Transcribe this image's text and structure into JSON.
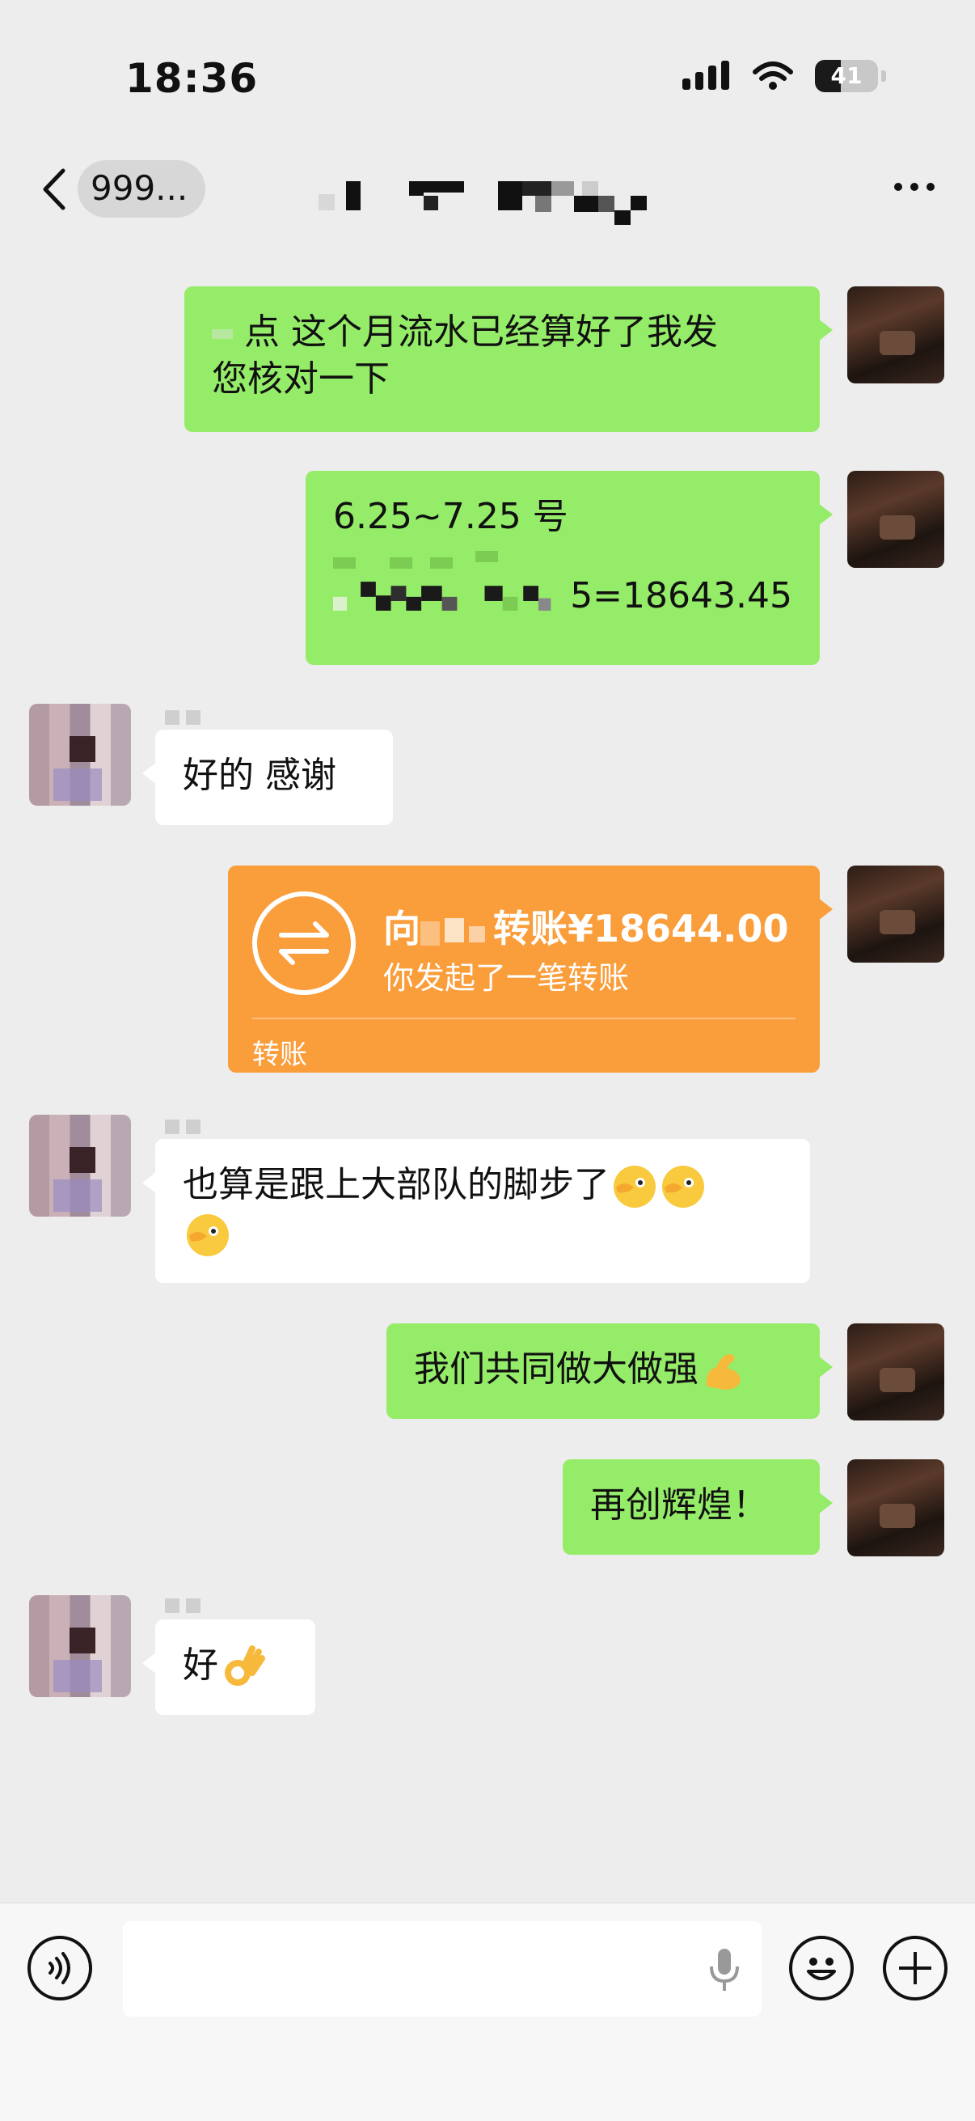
{
  "status_bar": {
    "time": "18:36",
    "battery_level": "41"
  },
  "nav": {
    "back_label": "999...",
    "more_icon": "more-horizontal-icon"
  },
  "messages": [
    {
      "sender": "self",
      "type": "text",
      "line1": "点 这个月流水已经算好了我发",
      "line2": "您核对一下"
    },
    {
      "sender": "self",
      "type": "text",
      "line1": "6.25~7.25 号",
      "line3_visible": "5=18643.45"
    },
    {
      "sender": "other",
      "type": "text",
      "text": "好的 感谢"
    },
    {
      "sender": "self",
      "type": "transfer",
      "prefix": "向",
      "amount": "转账¥18644.00",
      "subtitle": "你发起了一笔转账",
      "label": "转账"
    },
    {
      "sender": "other",
      "type": "text",
      "line1": "也算是跟上大部队的脚步了",
      "emoji": "face-with-hand-over-eye-emoji"
    },
    {
      "sender": "self",
      "type": "text",
      "text": "我们共同做大做强",
      "emoji": "flexed-biceps-emoji"
    },
    {
      "sender": "self",
      "type": "text",
      "text": "再创辉煌！"
    },
    {
      "sender": "other",
      "type": "text",
      "text": "好",
      "emoji": "ok-hand-emoji"
    }
  ],
  "input_bar": {
    "voice_icon": "voice-icon",
    "mic_icon": "microphone-icon",
    "emoji_icon": "smiley-icon",
    "plus_icon": "plus-icon"
  },
  "colors": {
    "background": "#ededed",
    "self_bubble": "#95ec69",
    "other_bubble": "#ffffff",
    "transfer_card": "#fa9d3b"
  }
}
